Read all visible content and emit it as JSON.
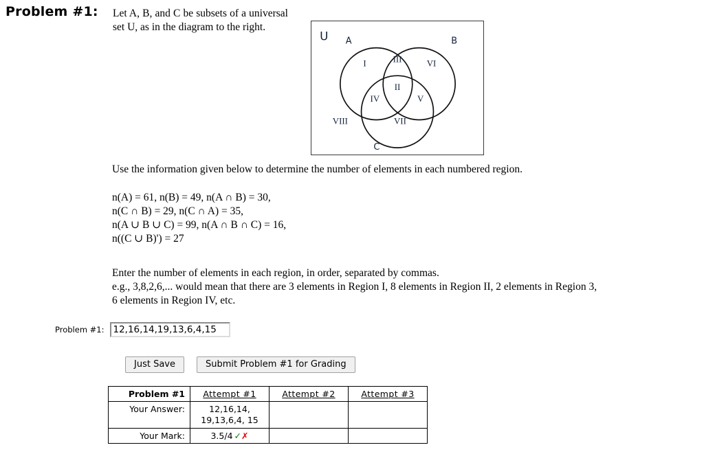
{
  "heading": "Problem #1:",
  "intro_text": "Let A, B, and C be subsets of a universal set U, as in the diagram to the right.",
  "venn": {
    "universe_label": "U",
    "set_labels": {
      "a": "A",
      "b": "B",
      "c": "C"
    },
    "regions": [
      "I",
      "II",
      "III",
      "IV",
      "V",
      "VI",
      "VII",
      "VIII"
    ],
    "region_I": "I",
    "region_II": "II",
    "region_III": "III",
    "region_IV": "IV",
    "region_V": "V",
    "region_VI": "VI",
    "region_VII": "VII",
    "region_VIII": "VIII"
  },
  "use_info_line": "Use the information given below to determine the number of elements in each numbered region.",
  "given_values": {
    "line1": "n(A) = 61, n(B) = 49, n(A ∩ B) = 30,",
    "line2": "n(C ∩ B) = 29, n(C ∩ A) = 35,",
    "line3": "n(A ∪ B ∪ C) = 99, n(A ∩ B ∩ C) = 16,",
    "line4": "n((C ∪ B)') = 27"
  },
  "instructions": {
    "line1": "Enter the number of elements in each region, in order, separated by commas.",
    "line2": "e.g., 3,8,2,6,... would mean that there are 3 elements in Region I, 8 elements in Region II, 2 elements in Region 3,",
    "line3": "6 elements in Region IV, etc."
  },
  "answer": {
    "label": "Problem #1:",
    "value": "12,16,14,19,13,6,4,15",
    "placeholder": ""
  },
  "buttons": {
    "just_save": "Just Save",
    "submit": "Submit Problem #1 for Grading"
  },
  "results_table": {
    "header": {
      "problem": "Problem #1",
      "attempt1": "Attempt #1",
      "attempt2": "Attempt #2",
      "attempt3": "Attempt #3"
    },
    "rows": [
      {
        "label": "Your Answer:",
        "attempt1": "12,16,14, 19,13,6,4, 15",
        "attempt2": "",
        "attempt3": ""
      },
      {
        "label": "Your Mark:",
        "attempt1": "3.5/4",
        "attempt1_check": "✓",
        "attempt1_cross": "✗",
        "attempt2": "",
        "attempt3": ""
      }
    ]
  },
  "colors": {
    "check_green": "#067806",
    "cross_red": "#e00000",
    "label_navy": "#14213a",
    "border_gray": "#3a3a3a"
  }
}
